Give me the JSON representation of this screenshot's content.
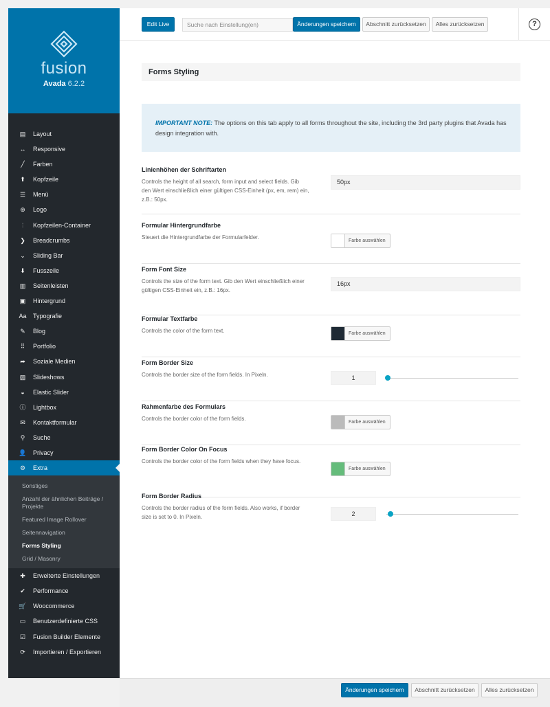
{
  "brand": {
    "wordmark": "fusion",
    "product": "Avada",
    "version": "6.2.2"
  },
  "nav_upper": [
    {
      "label": "Layout",
      "icon": "layout-icon",
      "glyph": "▤"
    },
    {
      "label": "Responsive",
      "icon": "arrows-horizontal-icon",
      "glyph": "↔"
    },
    {
      "label": "Farben",
      "icon": "brush-icon",
      "glyph": "╱"
    },
    {
      "label": "Kopfzeile",
      "icon": "arrow-up-icon",
      "glyph": "⬆"
    },
    {
      "label": "Menü",
      "icon": "menu-icon",
      "glyph": "☰"
    },
    {
      "label": "Logo",
      "icon": "plus-circle-icon",
      "glyph": "⊕"
    },
    {
      "label": "Kopfzeilen-Container",
      "icon": "sliders-icon",
      "glyph": "⫶"
    },
    {
      "label": "Breadcrumbs",
      "icon": "chevron-right-icon",
      "glyph": "❯"
    },
    {
      "label": "Sliding Bar",
      "icon": "chevron-down-icon",
      "glyph": "⌄"
    },
    {
      "label": "Fusszeile",
      "icon": "arrow-down-icon",
      "glyph": "⬇"
    },
    {
      "label": "Seitenleisten",
      "icon": "sidebar-icon",
      "glyph": "▥"
    },
    {
      "label": "Hintergrund",
      "icon": "background-icon",
      "glyph": "▣"
    },
    {
      "label": "Typografie",
      "icon": "typography-icon",
      "glyph": "Aa"
    },
    {
      "label": "Blog",
      "icon": "edit-icon",
      "glyph": "✎"
    },
    {
      "label": "Portfolio",
      "icon": "grid-icon",
      "glyph": "⠿"
    },
    {
      "label": "Soziale Medien",
      "icon": "share-icon",
      "glyph": "➦"
    },
    {
      "label": "Slideshows",
      "icon": "image-icon",
      "glyph": "▨"
    },
    {
      "label": "Elastic Slider",
      "icon": "slider-icon",
      "glyph": "◒"
    },
    {
      "label": "Lightbox",
      "icon": "info-icon",
      "glyph": "ⓘ"
    },
    {
      "label": "Kontaktformular",
      "icon": "mail-icon",
      "glyph": "✉"
    },
    {
      "label": "Suche",
      "icon": "search-icon",
      "glyph": "⚲"
    },
    {
      "label": "Privacy",
      "icon": "user-icon",
      "glyph": "👤"
    },
    {
      "label": "Extra",
      "icon": "cogs-icon",
      "glyph": "⚙",
      "active": true
    }
  ],
  "subnav": [
    {
      "label": "Sonstiges"
    },
    {
      "label": "Anzahl der ähnlichen Beiträge / Projekte"
    },
    {
      "label": "Featured Image Rollover"
    },
    {
      "label": "Seitennavigation"
    },
    {
      "label": "Forms Styling",
      "current": true
    },
    {
      "label": "Grid / Masonry"
    }
  ],
  "nav_lower": [
    {
      "label": "Erweiterte Einstellungen",
      "icon": "puzzle-icon",
      "glyph": "✚"
    },
    {
      "label": "Performance",
      "icon": "check-circle-icon",
      "glyph": "✔"
    },
    {
      "label": "Woocommerce",
      "icon": "cart-icon",
      "glyph": "🛒"
    },
    {
      "label": "Benutzerdefinierte CSS",
      "icon": "css-icon",
      "glyph": "▭"
    },
    {
      "label": "Fusion Builder Elemente",
      "icon": "checkbox-icon",
      "glyph": "☑"
    },
    {
      "label": "Importieren / Exportieren",
      "icon": "refresh-icon",
      "glyph": "⟳"
    }
  ],
  "topbar": {
    "edit_live": "Edit Live",
    "search_placeholder": "Suche nach Einstellung(en)",
    "save": "Änderungen speichern",
    "reset_section": "Abschnitt zurücksetzen",
    "reset_all": "Alles zurücksetzen",
    "help": "?"
  },
  "section_title": "Forms Styling",
  "notice": {
    "lead": "IMPORTANT NOTE:",
    "text": " The options on this tab apply to all forms throughout the site, including the 3rd party plugins that Avada has design integration with."
  },
  "options": [
    {
      "title": "Linienhöhen der Schriftarten",
      "desc": "Controls the height of all search, form input and select fields. Gib den Wert einschließlich einer gültigen CSS-Einheit (px, em, rem) ein, z.B.: 50px.",
      "value": "50px"
    },
    {
      "title": "Formular Hintergrundfarbe",
      "desc": "Steuert die Hintergrundfarbe der Formularfelder.",
      "color": "#ffffff",
      "button": "Farbe auswählen"
    },
    {
      "title": "Form Font Size",
      "desc": "Controls the size of the form text. Gib den Wert einschließlich einer gültigen CSS-Einheit ein, z.B.: 16px.",
      "value": "16px"
    },
    {
      "title": "Formular Textfarbe",
      "desc": "Controls the color of the form text.",
      "color": "#1f2a35",
      "button": "Farbe auswählen"
    },
    {
      "title": "Form Border Size",
      "desc": "Controls the border size of the form fields. In Pixeln.",
      "value": "1",
      "slider_fraction": 0.0
    },
    {
      "title": "Rahmenfarbe des Formulars",
      "desc": "Controls the border color of the form fields.",
      "color": "#bbbbbb",
      "button": "Farbe auswählen"
    },
    {
      "title": "Form Border Color On Focus",
      "desc": "Controls the border color of the form fields when they have focus.",
      "color": "#65bc7b",
      "button": "Farbe auswählen"
    },
    {
      "title": "Form Border Radius",
      "desc": "Controls the border radius of the form fields. Also works, if border size is set to 0. In Pixeln.",
      "value": "2",
      "slider_fraction": 0.02
    }
  ],
  "footer": {
    "save": "Änderungen speichern",
    "reset_section": "Abschnitt zurücksetzen",
    "reset_all": "Alles zurücksetzen"
  }
}
